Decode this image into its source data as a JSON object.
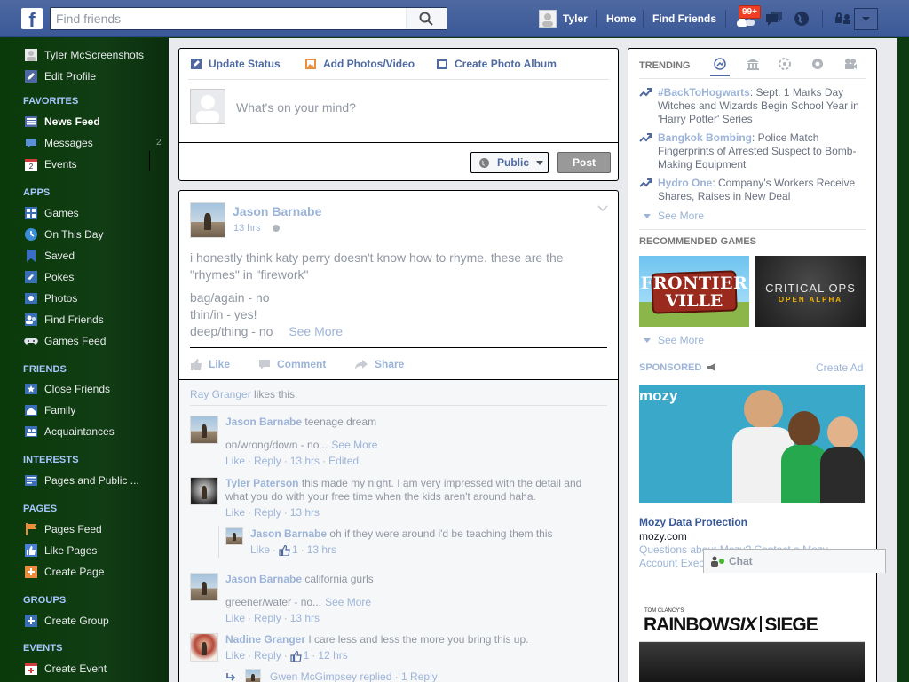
{
  "topbar": {
    "logo": "f",
    "search_placeholder": "Find friends",
    "user_name": "Tyler",
    "home": "Home",
    "find_friends": "Find Friends",
    "friend_requests_badge": "99+",
    "icons": [
      "facebook-logo",
      "search-icon",
      "friend-requests-icon",
      "messages-icon",
      "notifications-globe-icon",
      "privacy-icon",
      "account-menu-icon"
    ]
  },
  "sidebar": {
    "profile": [
      {
        "label": "Tyler McScreenshots",
        "icon": "avatar"
      },
      {
        "label": "Edit Profile",
        "icon": "pencil-icon"
      }
    ],
    "favorites_head": "FAVORITES",
    "favorites": [
      {
        "label": "News Feed",
        "icon": "news-feed-icon"
      },
      {
        "label": "Messages",
        "icon": "messages-icon",
        "count": "2"
      },
      {
        "label": "Events",
        "icon": "calendar-icon",
        "day": "2"
      }
    ],
    "apps_head": "APPS",
    "apps": [
      {
        "label": "Games",
        "icon": "games-icon"
      },
      {
        "label": "On This Day",
        "icon": "on-this-day-icon"
      },
      {
        "label": "Saved",
        "icon": "bookmark-icon"
      },
      {
        "label": "Pokes",
        "icon": "poke-icon"
      },
      {
        "label": "Photos",
        "icon": "photos-icon"
      },
      {
        "label": "Find Friends",
        "icon": "find-friends-icon"
      },
      {
        "label": "Games Feed",
        "icon": "gamepad-icon"
      }
    ],
    "friends_head": "FRIENDS",
    "friends": [
      {
        "label": "Close Friends",
        "icon": "star-list-icon"
      },
      {
        "label": "Family",
        "icon": "family-icon"
      },
      {
        "label": "Acquaintances",
        "icon": "acquaintances-icon"
      }
    ],
    "interests_head": "INTERESTS",
    "interests": [
      {
        "label": "Pages and Public ...",
        "icon": "pages-list-icon"
      }
    ],
    "pages_head": "PAGES",
    "pages": [
      {
        "label": "Pages Feed",
        "icon": "flag-icon"
      },
      {
        "label": "Like Pages",
        "icon": "thumbs-up-icon"
      },
      {
        "label": "Create Page",
        "icon": "add-icon"
      }
    ],
    "groups_head": "GROUPS",
    "groups": [
      {
        "label": "Create Group",
        "icon": "add-icon"
      }
    ],
    "events_head": "EVENTS",
    "events": [
      {
        "label": "Create Event",
        "icon": "add-event-icon"
      }
    ]
  },
  "composer": {
    "update_status": "Update Status",
    "add_photos": "Add Photos/Video",
    "create_album": "Create Photo Album",
    "placeholder": "What's on your mind?",
    "audience": "Public",
    "post": "Post"
  },
  "story": {
    "author": "Jason Barnabe",
    "time": "13 hrs",
    "text_line1": "i honestly think katy perry doesn't know how to rhyme. these are the",
    "text_line2": "\"rhymes\" in \"firework\"",
    "rhyme1": "bag/again - no",
    "rhyme2": "thin/in - yes!",
    "rhyme3": "deep/thing - no",
    "see_more": "See More",
    "like": "Like",
    "comment": "Comment",
    "share": "Share",
    "likes_name": "Ray Granger",
    "likes_suffix": " likes this.",
    "comments": [
      {
        "author": "Jason Barnabe",
        "text": " teenage dream",
        "line2": "on/wrong/down - no...",
        "see_more": "See More",
        "like": "Like",
        "reply": "Reply",
        "time": "13 hrs",
        "edited": "Edited"
      },
      {
        "author": "Tyler Paterson",
        "text": " this made my night. I am very impressed with the detail and",
        "line2": "what you do with your free time when the kids aren't around haha.",
        "like": "Like",
        "reply": "Reply",
        "time": "13 hrs"
      },
      {
        "author": "Jason Barnabe",
        "text": " oh if they were around i'd be teaching them this",
        "like": "Like",
        "likes": "1",
        "time": "13 hrs"
      },
      {
        "author": "Jason Barnabe",
        "text": " california gurls",
        "line2": "greener/water - no...",
        "see_more": "See More",
        "like": "Like",
        "reply": "Reply",
        "time": "13 hrs"
      },
      {
        "author": "Nadine Granger",
        "text": " I care less and less the more you bring this up.",
        "like": "Like",
        "reply": "Reply",
        "likes": "1",
        "time": "12 hrs"
      }
    ],
    "reply_thread": "Gwen McGimpsey replied · 1 Reply"
  },
  "right": {
    "trending_head": "TRENDING",
    "trends": [
      {
        "topic": "#BackToHogwarts",
        "desc": ": Sept. 1 Marks Day Witches and Wizards Begin School Year in 'Harry Potter' Series"
      },
      {
        "topic": "Bangkok Bombing",
        "desc": ": Police Match Fingerprints of Arrested Suspect to Bomb-Making Equipment"
      },
      {
        "topic": "Hydro One",
        "desc": ": Company's Workers Receive Shares, Raises in New Deal"
      }
    ],
    "see_more": "See More",
    "games_head": "RECOMMENDED GAMES",
    "game1_line1": "FRONTIER",
    "game1_line2": "VILLE",
    "game2_line1": "CRITICAL OPS",
    "game2_line2": "OPEN ALPHA",
    "sponsored_head": "SPONSORED",
    "create_ad": "Create Ad",
    "ad_brand": "mozy",
    "ad_title": "Mozy Data Protection",
    "ad_domain": "mozy.com",
    "ad_text_line1": "Questions about Mozy? Contact a Mozy",
    "ad_text_line2": "Account Executive",
    "ad2_brand": "TOM CLANCY'S",
    "ad2_title_a": "RAINBOW",
    "ad2_title_b": "SIX",
    "ad2_title_c": "SIEGE",
    "chat": "Chat"
  },
  "colors": {
    "brand": "#3b5998",
    "link": "#9cb4d8",
    "badge": "#f03d25",
    "sidebar": "#0d3b12"
  }
}
